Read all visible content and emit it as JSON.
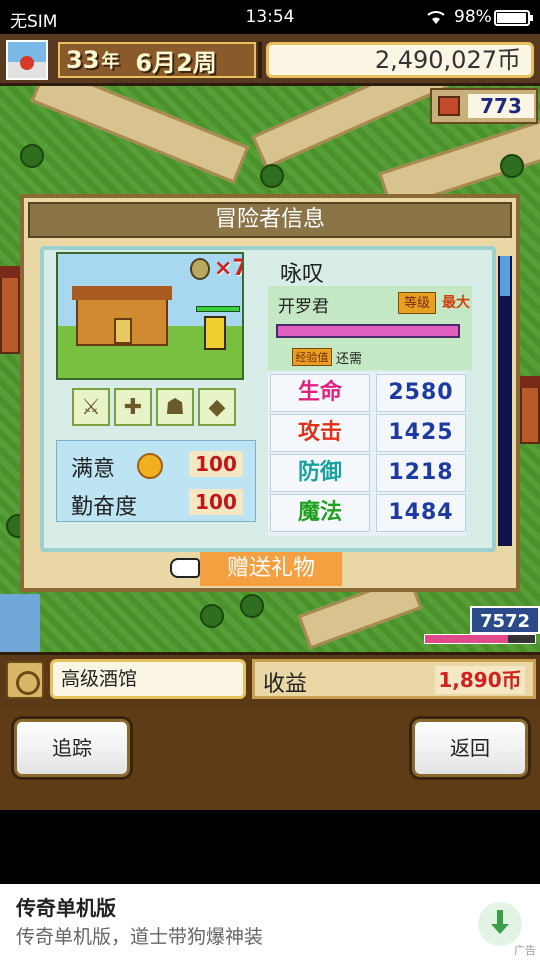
{
  "status_bar": {
    "carrier": "无SIM",
    "time": "13:54",
    "battery": "98%"
  },
  "hud": {
    "year_num": "33",
    "year_unit": "年",
    "month_week": "6月2周",
    "money": "2,490,027币",
    "population": "773",
    "right_counter": "7572"
  },
  "panel": {
    "title": "冒险者信息",
    "medal_count": "×7",
    "name": "咏叹",
    "origin": "开罗君",
    "level_label": "等级",
    "level_value": "最大",
    "exp_label": "经验值",
    "exp_value": "还需",
    "satisfaction_label": "满意",
    "satisfaction_value": "100",
    "diligence_label": "勤奋度",
    "diligence_value": "100",
    "stats": [
      {
        "label": "生命",
        "value": "2580"
      },
      {
        "label": "攻击",
        "value": "1425"
      },
      {
        "label": "防御",
        "value": "1218"
      },
      {
        "label": "魔法",
        "value": "1484"
      }
    ],
    "gift_label": "赠送礼物"
  },
  "bottom": {
    "location": "高级酒馆",
    "income_label": "收益",
    "income_value": "1,890币",
    "track_label": "追踪",
    "back_label": "返回"
  },
  "ad": {
    "title": "传奇单机版",
    "subtitle": "传奇单机版，道士带狗爆神装",
    "tag": "广告"
  }
}
